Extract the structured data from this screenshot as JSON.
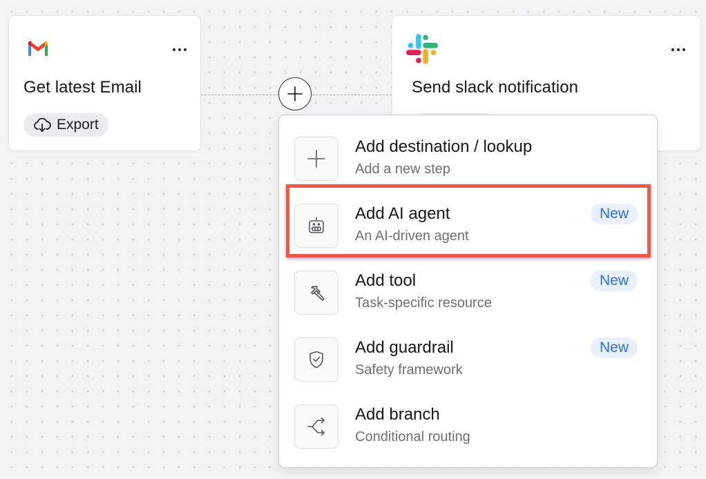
{
  "nodes": {
    "gmail": {
      "icon": "gmail-logo-icon",
      "title": "Get latest Email",
      "action_label": "Export",
      "action_icon": "cloud-download-icon"
    },
    "slack": {
      "icon": "slack-logo-icon",
      "title": "Send slack notification"
    }
  },
  "menu": {
    "items": [
      {
        "label": "Add destination / lookup",
        "description": "Add a new step",
        "icon": "plus-icon",
        "badge": ""
      },
      {
        "label": "Add AI agent",
        "description": "An AI-driven agent",
        "icon": "robot-icon",
        "badge": "New",
        "highlighted": true
      },
      {
        "label": "Add tool",
        "description": "Task-specific resource",
        "icon": "hammer-icon",
        "badge": "New"
      },
      {
        "label": "Add guardrail",
        "description": "Safety framework",
        "icon": "shield-check-icon",
        "badge": "New"
      },
      {
        "label": "Add branch",
        "description": "Conditional routing",
        "icon": "branch-icon",
        "badge": ""
      }
    ]
  },
  "colors": {
    "highlight": "#f0574b",
    "badge_bg": "#e7f0fc",
    "badge_text": "#2f6fd1"
  }
}
